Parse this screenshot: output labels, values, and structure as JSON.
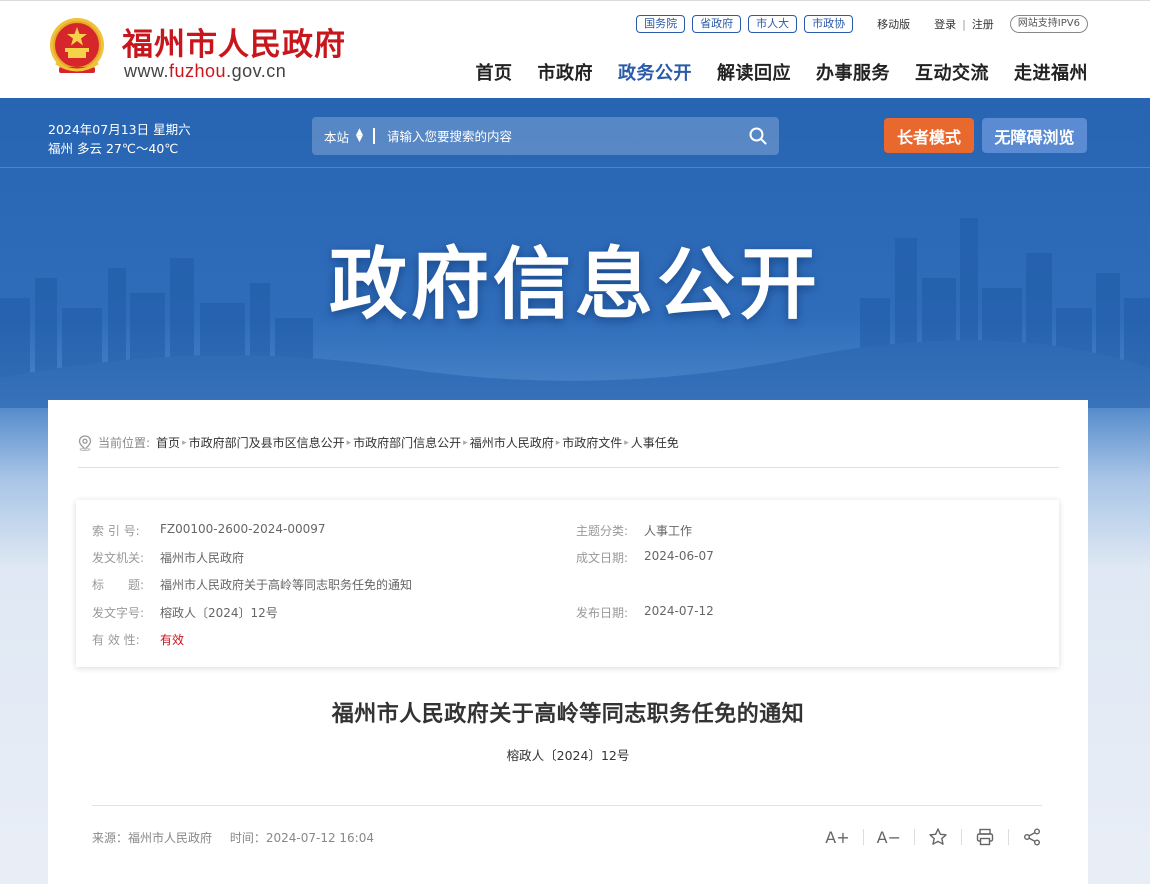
{
  "header": {
    "site_name": "福州市人民政府",
    "url_prefix": "www.",
    "url_highlight": "fuzhou",
    "url_suffix": ".gov.cn",
    "top_links": [
      "国务院",
      "省政府",
      "市人大",
      "市政协"
    ],
    "mobile": "移动版",
    "login": "登录",
    "register": "注册",
    "ipv6": "网站支持IPV6",
    "nav": [
      "首页",
      "市政府",
      "政务公开",
      "解读回应",
      "办事服务",
      "互动交流",
      "走进福州"
    ],
    "active_nav": "政务公开",
    "brand_color": "#c8161d",
    "accent_color": "#2a5aa8"
  },
  "banner": {
    "date": "2024年07月13日 星期六",
    "weather": "福州 多云 27℃～40℃",
    "search_scope": "本站",
    "search_placeholder": "请输入您要搜索的内容",
    "elder_mode": "长者模式",
    "accessible": "无障碍浏览",
    "title": "政府信息公开"
  },
  "breadcrumb": {
    "label": "当前位置:",
    "items": [
      "首页",
      "市政府部门及县市区信息公开",
      "市政府部门信息公开",
      "福州市人民政府",
      "市政府文件",
      "人事任免"
    ]
  },
  "meta": {
    "index_label": "索 引 号:",
    "index_value": "FZ00100-2600-2024-00097",
    "topic_label": "主题分类:",
    "topic_value": "人事工作",
    "issuer_label": "发文机关:",
    "issuer_value": "福州市人民政府",
    "created_label": "成文日期:",
    "created_value": "2024-06-07",
    "title_label": "标　　题:",
    "title_value": "福州市人民政府关于高岭等同志职务任免的通知",
    "docno_label": "发文字号:",
    "docno_value": "榕政人〔2024〕12号",
    "published_label": "发布日期:",
    "published_value": "2024-07-12",
    "validity_label": "有 效 性:",
    "validity_value": "有效"
  },
  "document": {
    "title": "福州市人民政府关于高岭等同志职务任免的通知",
    "number": "榕政人〔2024〕12号",
    "source": "来源：福州市人民政府",
    "time": "时间：2024-07-12 16:04"
  },
  "tools": {
    "font_up": "A+",
    "font_down": "A−"
  }
}
